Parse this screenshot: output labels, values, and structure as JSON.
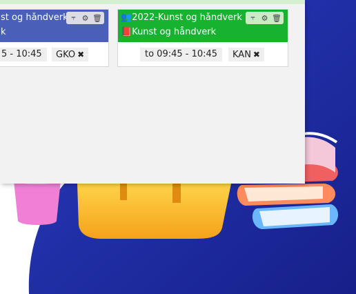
{
  "cards": [
    {
      "title": "st og håndverk 2",
      "subject": "k",
      "time": "5 - 10:45",
      "tag": "GKO",
      "remove_icon": "✖",
      "header_color": "#4a5fb7"
    },
    {
      "title": "2022-Kunst og håndverk 3",
      "subject": "Kunst og håndverk",
      "time": "to 09:45 - 10:45",
      "tag": "KAN",
      "remove_icon": "✖",
      "header_color": "#17b22f"
    }
  ],
  "icons": {
    "group": "group-icon",
    "book": "book-icon",
    "expand": "double-chevron-down-icon",
    "settings": "gear-icon",
    "delete": "trash-icon"
  },
  "colors": {
    "background_blob": "#2233a8",
    "panel": "#f2f2f2"
  }
}
